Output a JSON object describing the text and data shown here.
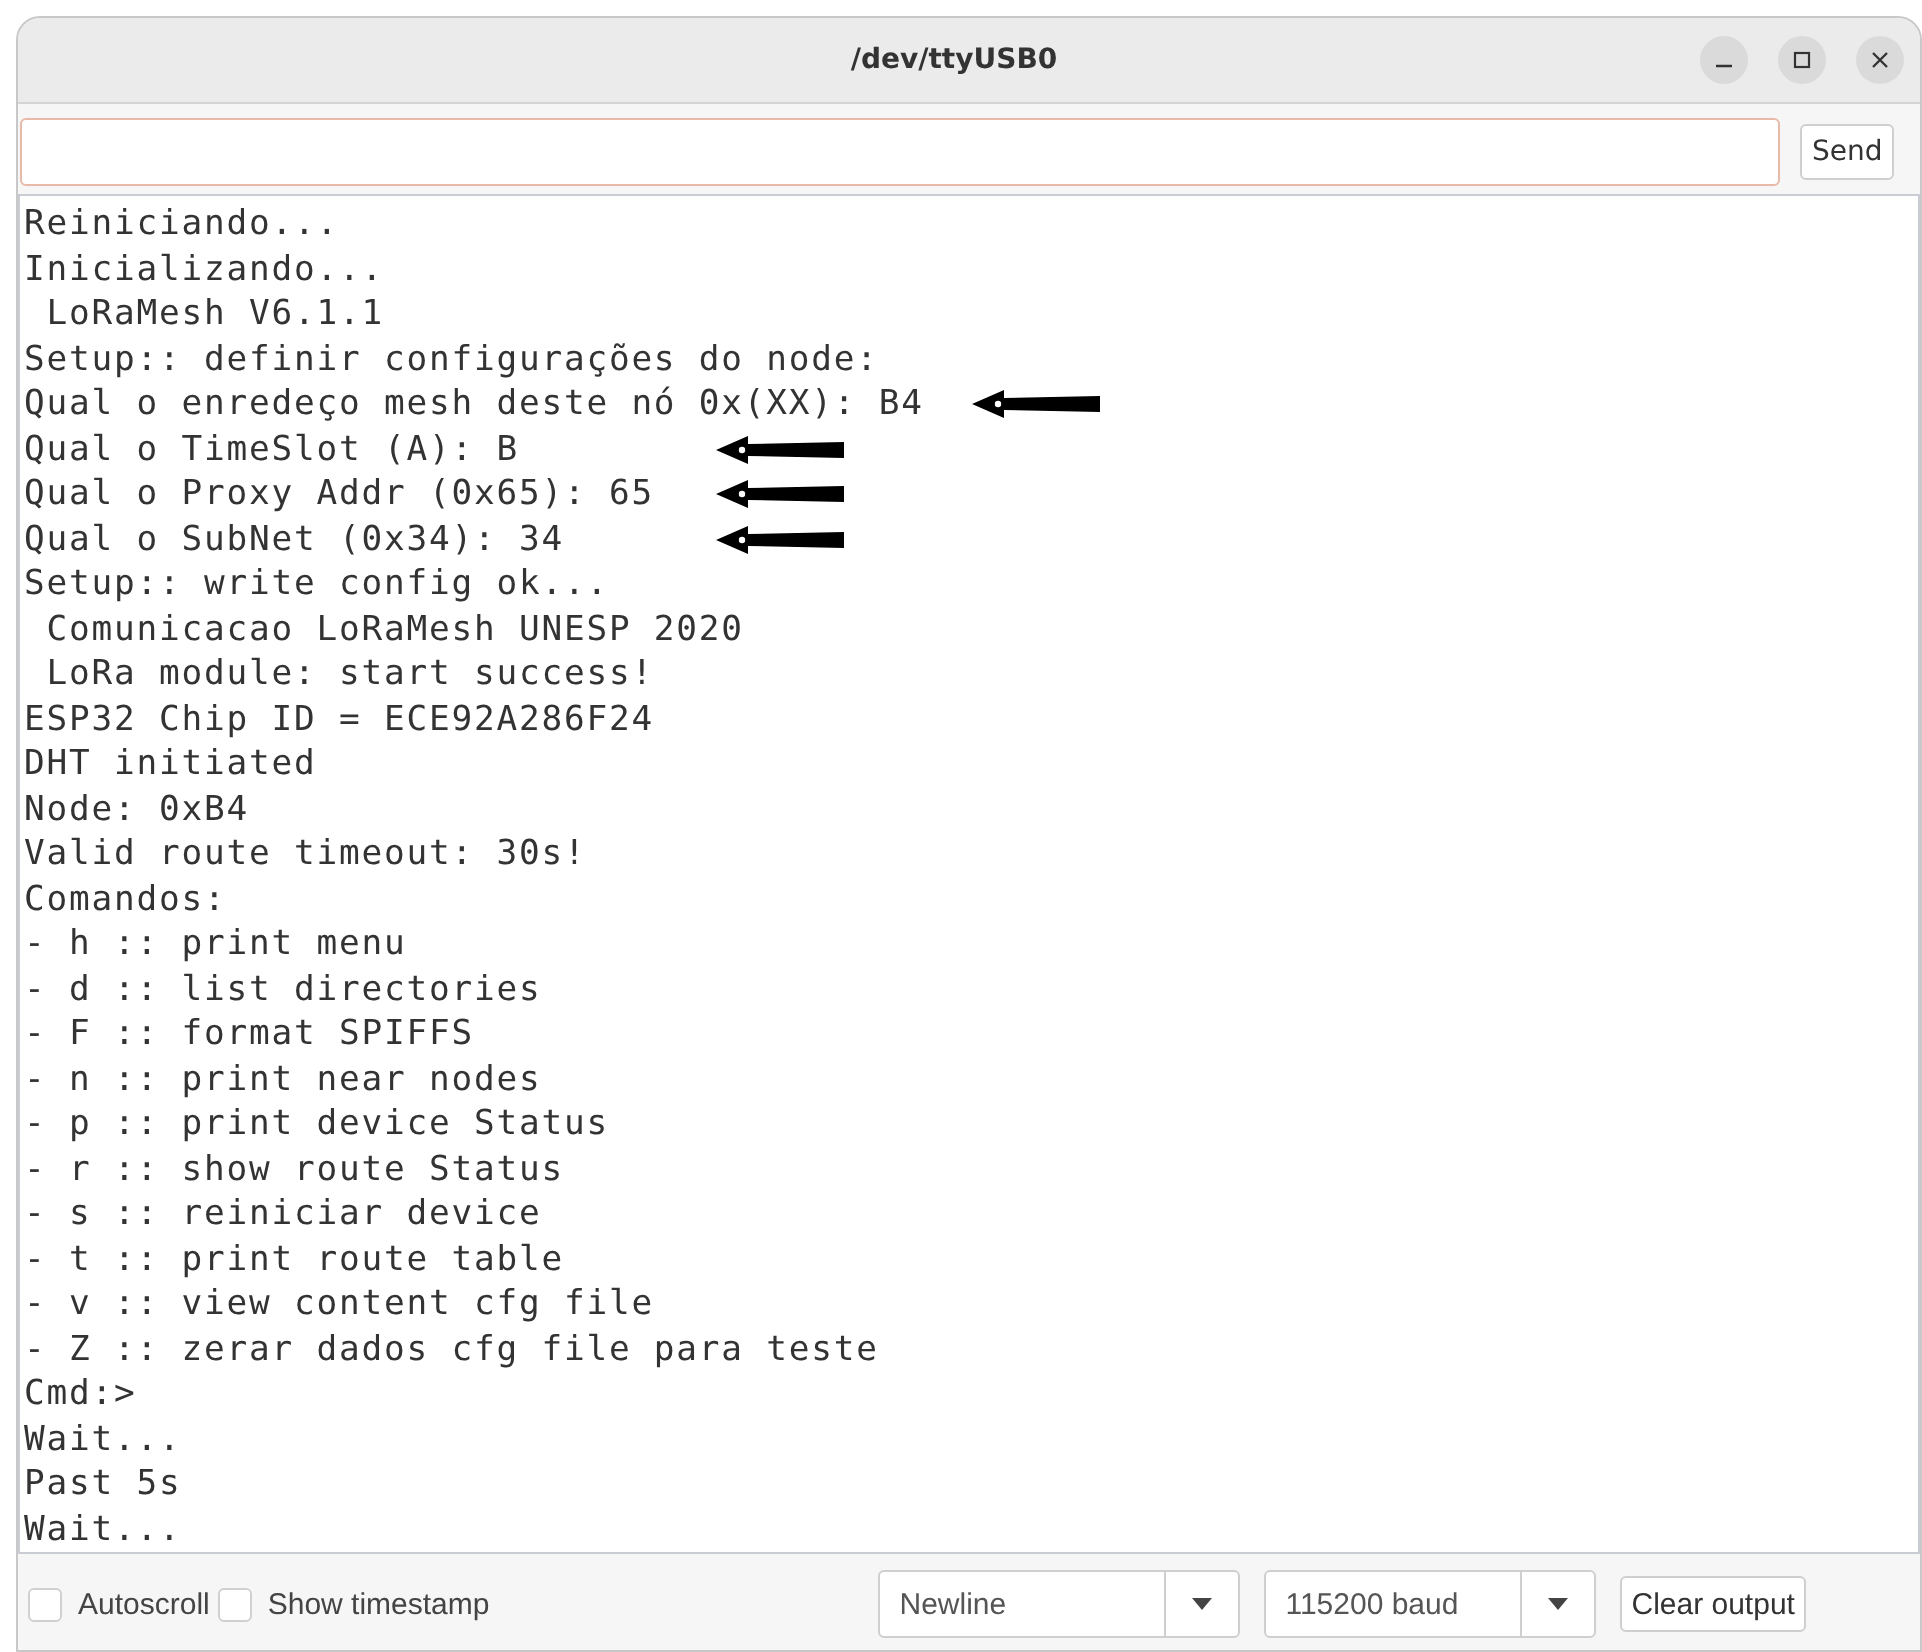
{
  "window": {
    "title": "/dev/ttyUSB0"
  },
  "send_button": "Send",
  "output": [
    {
      "text": "Reiniciando...",
      "arrow": false
    },
    {
      "text": "Inicializando...",
      "arrow": false
    },
    {
      "text": " LoRaMesh V6.1.1",
      "arrow": false
    },
    {
      "text": "Setup:: definir configurações do node:",
      "arrow": false
    },
    {
      "text": "Qual o enredeço mesh deste nó 0x(XX): B4",
      "arrow": true
    },
    {
      "text": "Qual o TimeSlot (A): B",
      "arrow": true
    },
    {
      "text": "Qual o Proxy Addr (0x65): 65",
      "arrow": true
    },
    {
      "text": "Qual o SubNet (0x34): 34",
      "arrow": true
    },
    {
      "text": "Setup:: write config ok...",
      "arrow": false
    },
    {
      "text": " Comunicacao LoRaMesh UNESP 2020",
      "arrow": false
    },
    {
      "text": " LoRa module: start success!",
      "arrow": false
    },
    {
      "text": "ESP32 Chip ID = ECE92A286F24",
      "arrow": false
    },
    {
      "text": "DHT initiated",
      "arrow": false
    },
    {
      "text": "Node: 0xB4",
      "arrow": false
    },
    {
      "text": "Valid route timeout: 30s!",
      "arrow": false
    },
    {
      "text": "Comandos:",
      "arrow": false
    },
    {
      "text": "- h :: print menu",
      "arrow": false
    },
    {
      "text": "- d :: list directories",
      "arrow": false
    },
    {
      "text": "- F :: format SPIFFS",
      "arrow": false
    },
    {
      "text": "- n :: print near nodes",
      "arrow": false
    },
    {
      "text": "- p :: print device Status",
      "arrow": false
    },
    {
      "text": "- r :: show route Status",
      "arrow": false
    },
    {
      "text": "- s :: reiniciar device",
      "arrow": false
    },
    {
      "text": "- t :: print route table",
      "arrow": false
    },
    {
      "text": "- v :: view content cfg file",
      "arrow": false
    },
    {
      "text": "- Z :: zerar dados cfg file para teste",
      "arrow": false
    },
    {
      "text": "Cmd:>",
      "arrow": false
    },
    {
      "text": "Wait...",
      "arrow": false
    },
    {
      "text": "Past 5s",
      "arrow": false
    },
    {
      "text": "Wait...",
      "arrow": false
    }
  ],
  "options": [
    {
      "label": "Autoscroll",
      "checked": false
    },
    {
      "label": "Show timestamp",
      "checked": false
    }
  ],
  "line_ending": "Newline",
  "baud_rate": "115200 baud",
  "clear_button": "Clear output"
}
